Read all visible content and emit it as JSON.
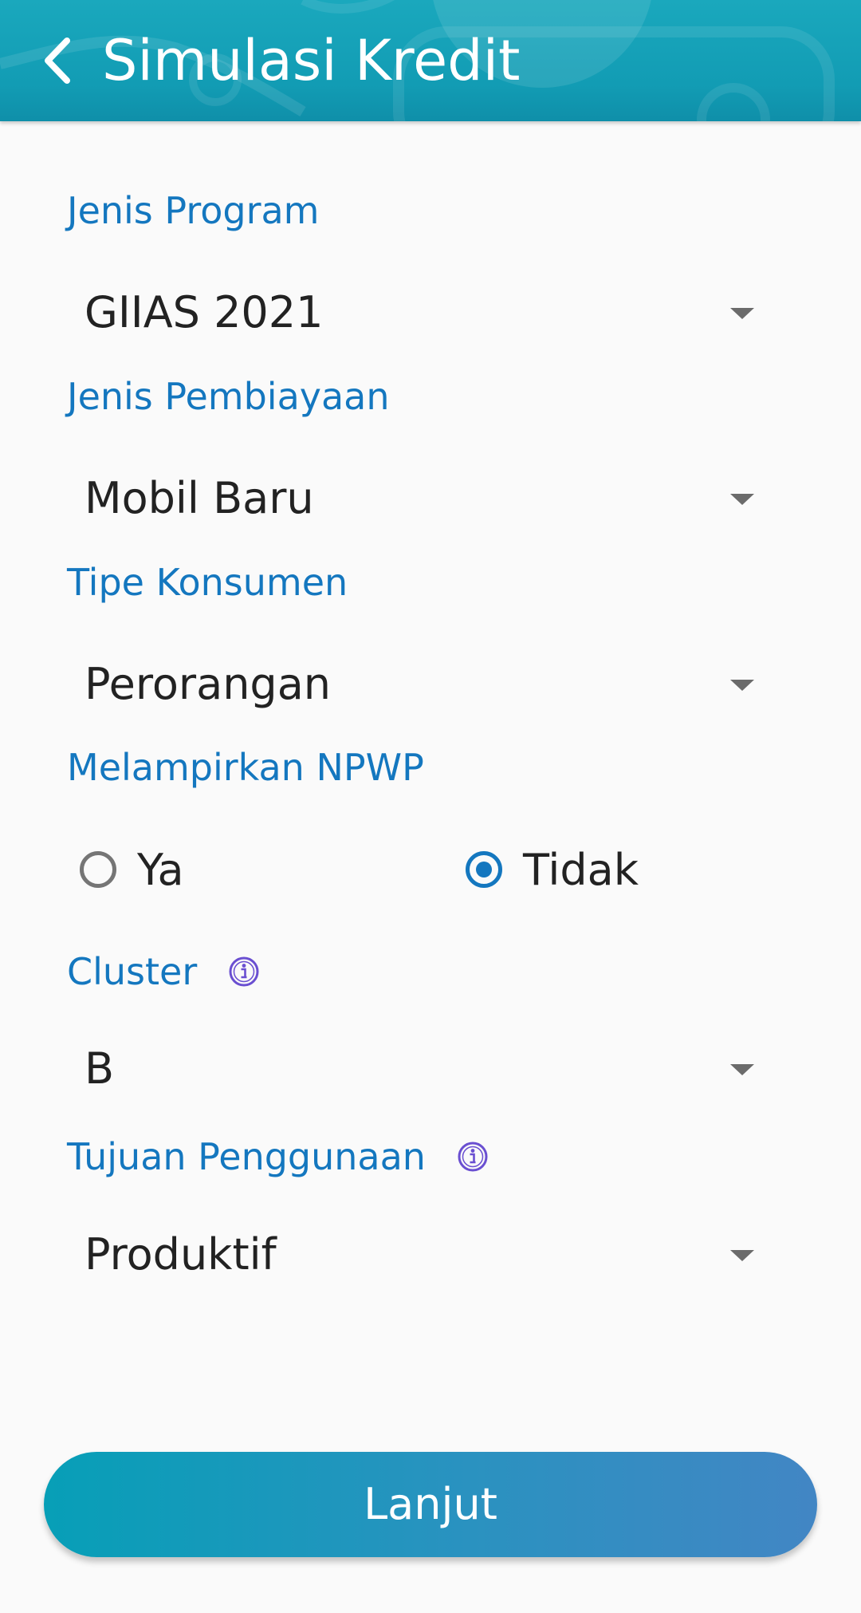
{
  "header": {
    "title": "Simulasi Kredit",
    "back_icon": "chevron-left-icon"
  },
  "colors": {
    "header_bg": "#129cb4",
    "label": "#1477bf",
    "value_text": "#222222",
    "caret": "#6b6b6b",
    "radio_selected": "#1477bf",
    "info_icon": "#6a4fd1",
    "cta_start": "#079fb7",
    "cta_end": "#4286c4"
  },
  "form": {
    "jenis_program": {
      "label": "Jenis Program",
      "value": "GIIAS 2021"
    },
    "jenis_pembiayaan": {
      "label": "Jenis Pembiayaan",
      "value": "Mobil Baru"
    },
    "tipe_konsumen": {
      "label": "Tipe Konsumen",
      "value": "Perorangan"
    },
    "npwp": {
      "label": "Melampirkan NPWP",
      "options": [
        {
          "label": "Ya",
          "selected": false
        },
        {
          "label": "Tidak",
          "selected": true
        }
      ]
    },
    "cluster": {
      "label": "Cluster",
      "value": "B",
      "info_icon": "info-icon"
    },
    "tujuan_penggunaan": {
      "label": "Tujuan Penggunaan",
      "value": "Produktif",
      "info_icon": "info-icon"
    }
  },
  "cta": {
    "label": "Lanjut"
  }
}
